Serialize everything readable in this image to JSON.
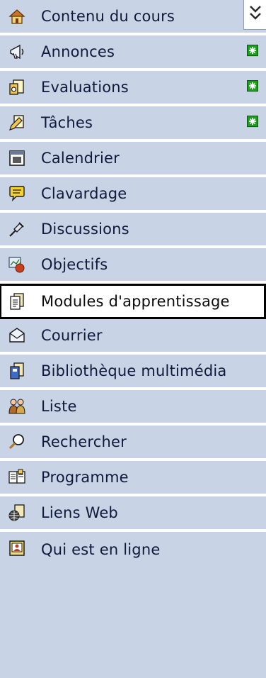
{
  "menu": {
    "selected_index": 8,
    "items": [
      {
        "label": "Contenu du cours",
        "icon": "course-content-icon",
        "new": false
      },
      {
        "label": "Annonces",
        "icon": "announcements-megaphone-icon",
        "new": true
      },
      {
        "label": "Evaluations",
        "icon": "evaluations-document-icon",
        "new": true
      },
      {
        "label": "Tâches",
        "icon": "assignments-pencil-icon",
        "new": true
      },
      {
        "label": "Calendrier",
        "icon": "calendar-icon",
        "new": false
      },
      {
        "label": "Clavardage",
        "icon": "chat-bubble-icon",
        "new": false
      },
      {
        "label": "Discussions",
        "icon": "discussions-pin-icon",
        "new": false
      },
      {
        "label": "Objectifs",
        "icon": "objectives-apple-icon",
        "new": false
      },
      {
        "label": "Modules d'apprentissage",
        "icon": "learning-modules-icon",
        "new": false
      },
      {
        "label": "Courrier",
        "icon": "mail-envelope-icon",
        "new": false
      },
      {
        "label": "Bibliothèque multimédia",
        "icon": "media-library-icon",
        "new": false
      },
      {
        "label": "Liste",
        "icon": "roster-people-icon",
        "new": false
      },
      {
        "label": "Rechercher",
        "icon": "search-magnifier-icon",
        "new": false
      },
      {
        "label": "Programme",
        "icon": "syllabus-icon",
        "new": false
      },
      {
        "label": "Liens Web",
        "icon": "web-links-globe-icon",
        "new": false
      },
      {
        "label": "Qui est en ligne",
        "icon": "who-is-online-icon",
        "new": false
      }
    ]
  },
  "colors": {
    "menu_bg": "#c8d3e6",
    "separator": "#ffffff",
    "text": "#0e1a3a",
    "new_badge": "#1e9d1e"
  },
  "collapse_icon": "double-chevron-down-icon"
}
